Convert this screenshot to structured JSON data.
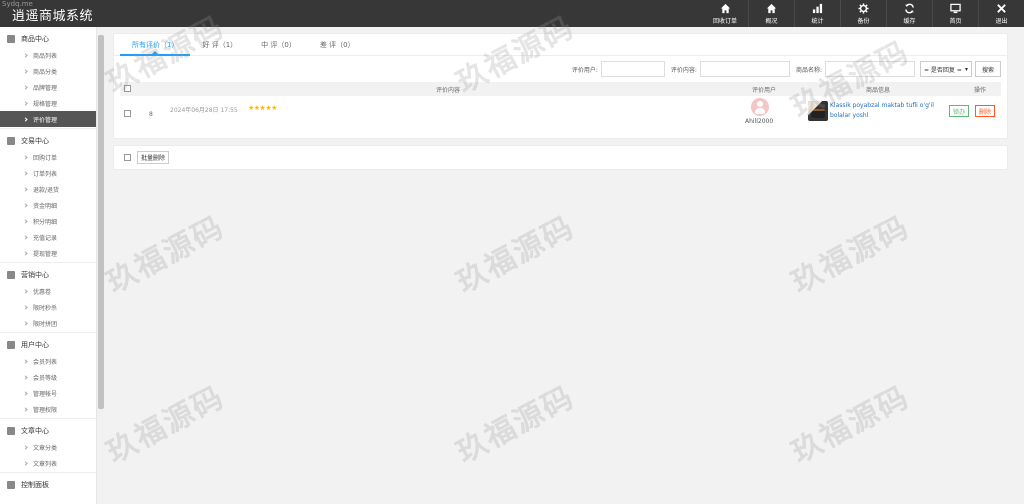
{
  "app": {
    "title": "逍遥商城系统",
    "sub": "Sydq.me"
  },
  "topnav": [
    {
      "label": "回收订单",
      "icon": "home-icon"
    },
    {
      "label": "概况",
      "icon": "home-icon"
    },
    {
      "label": "统计",
      "icon": "bar-chart-icon"
    },
    {
      "label": "备份",
      "icon": "gear-icon"
    },
    {
      "label": "缓存",
      "icon": "refresh-icon"
    },
    {
      "label": "首页",
      "icon": "monitor-icon"
    },
    {
      "label": "退出",
      "icon": "close-icon"
    }
  ],
  "sidebar": {
    "sections": [
      {
        "title": "商品中心",
        "items": [
          "商品列表",
          "商品分类",
          "品牌管理",
          "规格管理",
          "评价管理"
        ]
      },
      {
        "title": "交易中心",
        "items": [
          "回购订单",
          "订单列表",
          "退款/退货",
          "资金明细",
          "积分明细",
          "充值记录",
          "提现管理"
        ]
      },
      {
        "title": "营销中心",
        "items": [
          "优惠卷",
          "限时秒杀",
          "限时拼团"
        ]
      },
      {
        "title": "用户中心",
        "items": [
          "会员列表",
          "会员等级",
          "管理帐号",
          "管理权限"
        ]
      },
      {
        "title": "文章中心",
        "items": [
          "文章分类",
          "文章列表"
        ]
      },
      {
        "title": "控制面板",
        "items": []
      }
    ],
    "active": "评价管理"
  },
  "tabs": [
    "所有评价（1）",
    "好 评（1）",
    "中 评（0）",
    "差 评（0）"
  ],
  "filters": {
    "user_label": "评价用户:",
    "content_label": "评价内容:",
    "product_label": "商品名称:",
    "reply_select": "= 是否回复 =",
    "search_button": "搜索"
  },
  "table": {
    "headers": [
      "评价内容",
      "评价用户",
      "商品信息",
      "操作"
    ],
    "rows": [
      {
        "id": "8",
        "date": "2024年06月28日 17:55",
        "stars": "★★★★★",
        "user": "Ahill2000",
        "product": "Klassik poyabzal maktab tufli o'g'il bolalar yoshl",
        "approve": "锁办",
        "delete": "删除"
      }
    ]
  },
  "bulk_delete": "批量删除",
  "watermark": "玖福源码",
  "colors": {
    "topbar": "#373737",
    "accent": "#1e9fff",
    "star": "#ffb800",
    "approve": "#5fb878",
    "delete": "#ff5722"
  }
}
